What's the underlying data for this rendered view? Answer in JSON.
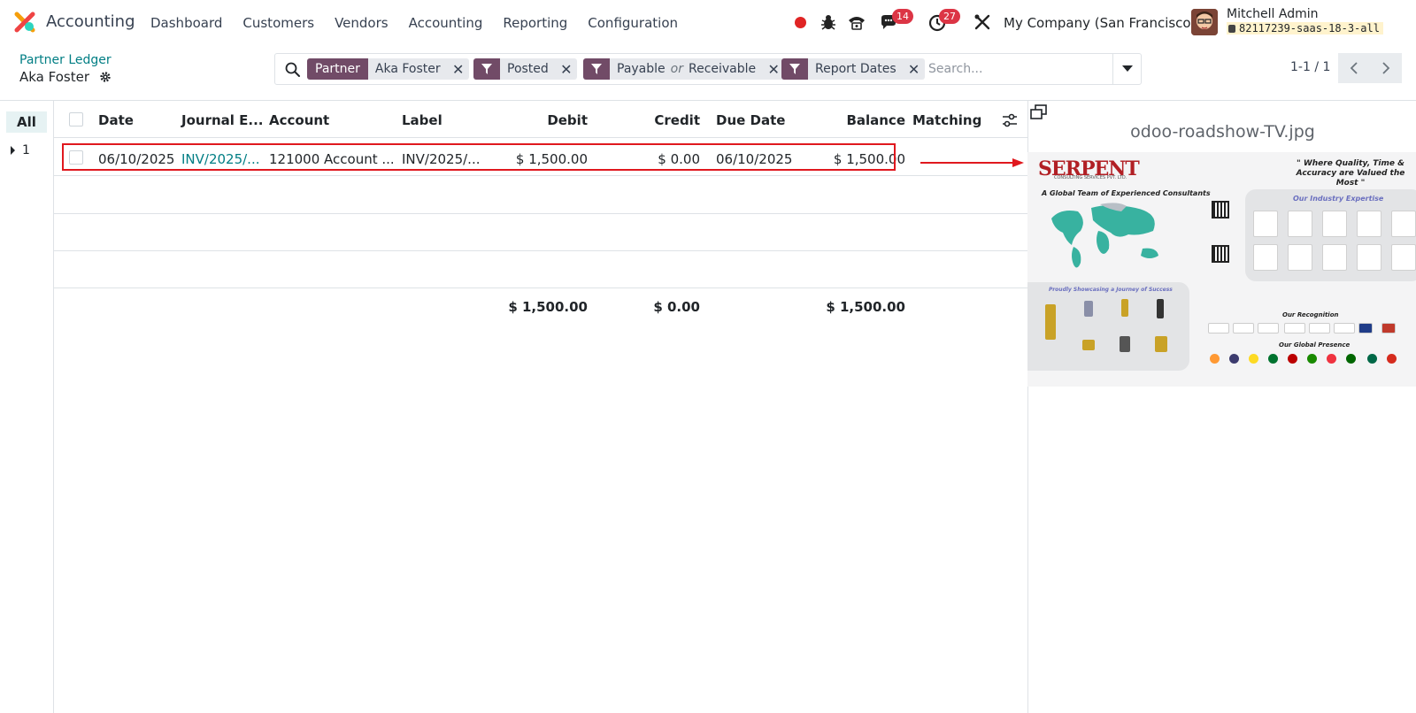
{
  "app": {
    "name": "Accounting"
  },
  "nav": {
    "items": [
      "Dashboard",
      "Customers",
      "Vendors",
      "Accounting",
      "Reporting",
      "Configuration"
    ]
  },
  "systray": {
    "messages_count": "14",
    "activities_count": "27",
    "company": "My Company (San Francisco)",
    "user_name": "Mitchell Admin",
    "db_name": "82117239-saas-18-3-all"
  },
  "control": {
    "breadcrumb": "Partner Ledger",
    "record_title": "Aka Foster",
    "search_placeholder": "Search...",
    "pager": "1-1 / 1",
    "facets": [
      {
        "label": "Partner",
        "value": "Aka Foster"
      },
      {
        "value": "Posted"
      },
      {
        "value_a": "Payable",
        "joiner": "or",
        "value_b": "Receivable"
      },
      {
        "value": "Report Dates"
      }
    ]
  },
  "sidebar": {
    "all_label": "All",
    "group_label": "1"
  },
  "table": {
    "headers": {
      "date": "Date",
      "journal_entry": "Journal E...",
      "account": "Account",
      "label": "Label",
      "debit": "Debit",
      "credit": "Credit",
      "due_date": "Due Date",
      "balance": "Balance",
      "matching": "Matching"
    },
    "rows": [
      {
        "date": "06/10/2025",
        "journal_entry": "INV/2025/...",
        "account": "121000 Account ...",
        "label": "INV/2025/...",
        "debit": "$ 1,500.00",
        "credit": "$ 0.00",
        "due_date": "06/10/2025",
        "balance": "$ 1,500.00",
        "matching": ""
      }
    ],
    "totals": {
      "debit": "$ 1,500.00",
      "credit": "$ 0.00",
      "balance": "$ 1,500.00"
    }
  },
  "preview": {
    "file_name": "odoo-roadshow-TV.jpg",
    "poster": {
      "brand": "SERPENT",
      "brand_sub": "CONSULTING SERVICES PVT. LTD.",
      "tagline": "\" Where Quality, Time & Accuracy are Valued the Most \"",
      "team_heading": "A Global Team of Experienced Consultants",
      "expertise_heading": "Our Industry Expertise",
      "success_heading": "Proudly Showcasing a Journey of Success",
      "recognition_heading": "Our Recognition",
      "presence_heading": "Our Global Presence"
    }
  },
  "colors": {
    "brand": "#714b67",
    "link": "#017e84",
    "highlight": "#e0181e",
    "badge": "#dc3545"
  }
}
